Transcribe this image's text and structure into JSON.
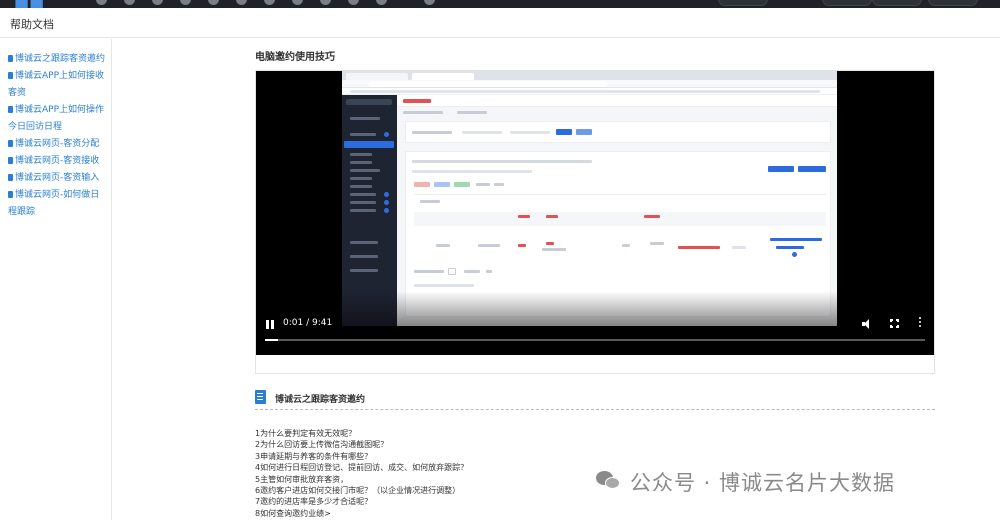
{
  "header": {
    "title": "帮助文档"
  },
  "sidebar": {
    "items": [
      {
        "label": "博诚云之跟踪客资邀约"
      },
      {
        "label": "博诚云APP上如何接收客资"
      },
      {
        "label": "博诚云APP上如何操作今日回访日程"
      },
      {
        "label": "博诚云网页-客资分配"
      },
      {
        "label": "博诚云网页-客资接收"
      },
      {
        "label": "博诚云网页-客资输入"
      },
      {
        "label": "博诚云网页-如何做日程跟踪"
      }
    ]
  },
  "main": {
    "section_title": "电脑邀约使用技巧",
    "video": {
      "time": "0:01 / 9:41",
      "progress_fraction": 0.0017,
      "controls": [
        "pause-icon",
        "volume-icon",
        "fullscreen-icon",
        "more-icon"
      ]
    },
    "list": {
      "title": "博诚云之跟踪客资邀约",
      "questions": [
        "1为什么要判定有效无效呢？",
        "2为什么回访要上传微信沟通截图呢？",
        "3申请延期与养客的条件有哪些？",
        "4如何进行日程回访登记、提前回访、成交、如何放弃跟踪？",
        "5主管如何审批放弃客资，",
        "6邀约客户进店如何交接门市呢？（以企业情况进行调整）",
        "7邀约的进店率是多少才合适呢？",
        "8如何查询邀约业绩>"
      ]
    }
  },
  "watermark": {
    "text": "公众号 · 博诚云名片大数据"
  },
  "colors": {
    "link": "#2a7fd4",
    "topbar": "#1f2329",
    "video_bg": "#000000"
  }
}
